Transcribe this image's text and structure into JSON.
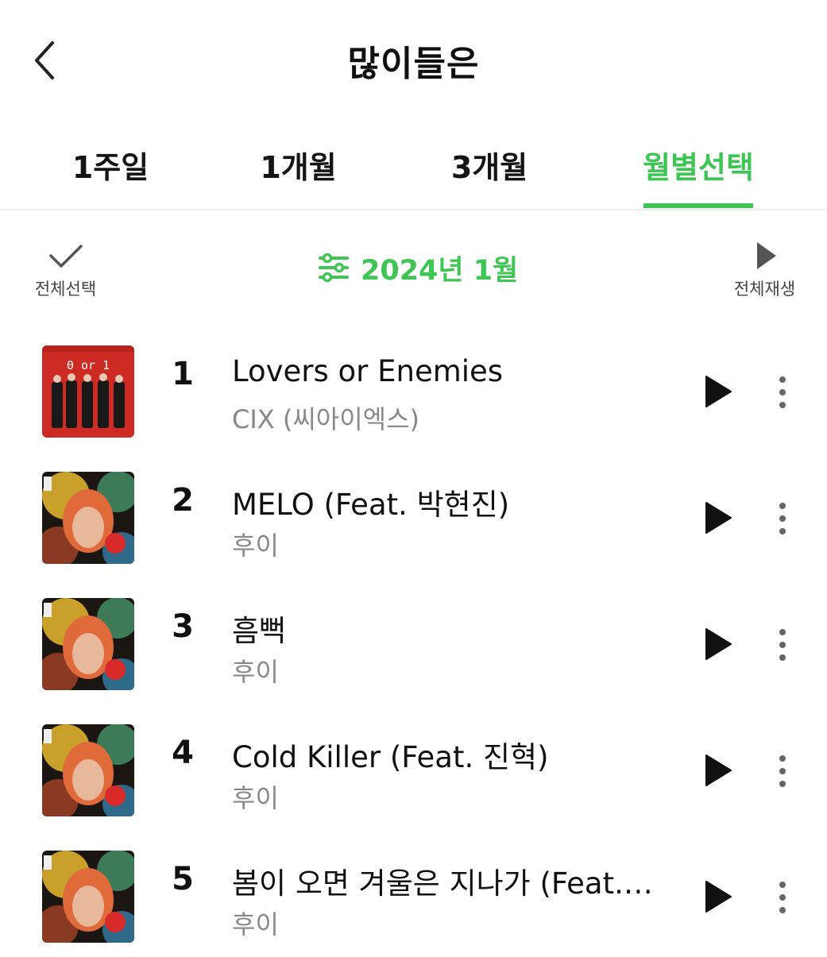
{
  "header": {
    "title": "많이들은"
  },
  "tabs": [
    {
      "label": "1주일",
      "active": false
    },
    {
      "label": "1개월",
      "active": false
    },
    {
      "label": "3개월",
      "active": false
    },
    {
      "label": "월별선택",
      "active": true
    }
  ],
  "toolbar": {
    "select_all_label": "전체선택",
    "month_label": "2024년 1월",
    "play_all_label": "전체재생"
  },
  "tracks": [
    {
      "rank": "1",
      "title": "Lovers or Enemies",
      "artist": "CIX (씨아이엑스)",
      "cover_text": "0 or 1"
    },
    {
      "rank": "2",
      "title": "MELO (Feat. 박현진)",
      "artist": "후이"
    },
    {
      "rank": "3",
      "title": "흠뻑",
      "artist": "후이"
    },
    {
      "rank": "4",
      "title": "Cold Killer (Feat. 진혁)",
      "artist": "후이"
    },
    {
      "rank": "5",
      "title": "봄이 오면 겨울은 지나가 (Feat.…",
      "artist": "후이"
    }
  ],
  "colors": {
    "accent": "#3fc554",
    "text": "#111111",
    "subtext": "#888888"
  },
  "icons": {
    "back": "chevron-left-icon",
    "select_all": "check-icon",
    "month_filter": "sliders-icon",
    "play_all": "play-icon",
    "play": "play-icon",
    "more": "more-vertical-icon"
  }
}
